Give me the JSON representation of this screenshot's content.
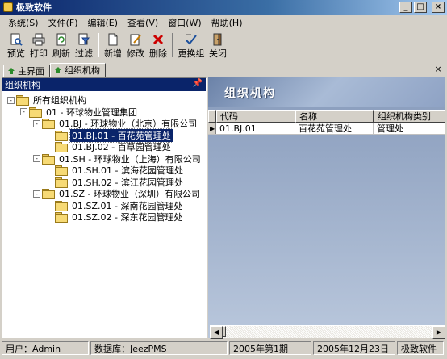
{
  "window": {
    "title": "极致软件"
  },
  "menu": [
    "系统(S)",
    "文件(F)",
    "编辑(E)",
    "查看(V)",
    "窗口(W)",
    "帮助(H)"
  ],
  "toolbar": [
    {
      "label": "预览",
      "icon": "preview-icon"
    },
    {
      "label": "打印",
      "icon": "print-icon"
    },
    {
      "label": "刷新",
      "icon": "refresh-icon"
    },
    {
      "label": "过滤",
      "icon": "filter-icon"
    },
    {
      "label": "新增",
      "icon": "add-icon"
    },
    {
      "label": "修改",
      "icon": "edit-icon"
    },
    {
      "label": "删除",
      "icon": "delete-icon"
    },
    {
      "label": "更换组",
      "icon": "change-group-icon"
    },
    {
      "label": "关闭",
      "icon": "close-icon"
    }
  ],
  "tabs": [
    {
      "label": "主界面"
    },
    {
      "label": "组织机构"
    }
  ],
  "left_panel": {
    "title": "组织机构",
    "tree": [
      {
        "label": "所有组织机构",
        "level": 0,
        "expander": "-"
      },
      {
        "label": "01 - 环球物业管理集团",
        "level": 1,
        "expander": "-"
      },
      {
        "label": "01.BJ - 环球物业（北京）有限公司",
        "level": 2,
        "expander": "-"
      },
      {
        "label": "01.BJ.01 - 百花苑管理处",
        "level": 3,
        "expander": "",
        "selected": true
      },
      {
        "label": "01.BJ.02 - 百草园管理处",
        "level": 3,
        "expander": ""
      },
      {
        "label": "01.SH - 环球物业（上海）有限公司",
        "level": 2,
        "expander": "-"
      },
      {
        "label": "01.SH.01 - 滨海花园管理处",
        "level": 3,
        "expander": ""
      },
      {
        "label": "01.SH.02 - 滨江花园管理处",
        "level": 3,
        "expander": ""
      },
      {
        "label": "01.SZ - 环球物业（深圳）有限公司",
        "level": 2,
        "expander": "-"
      },
      {
        "label": "01.SZ.01 - 深南花园管理处",
        "level": 3,
        "expander": ""
      },
      {
        "label": "01.SZ.02 - 深东花园管理处",
        "level": 3,
        "expander": ""
      }
    ]
  },
  "right_panel": {
    "banner_title": "组织机构",
    "columns": [
      "代码",
      "名称",
      "组织机构类别"
    ],
    "rows": [
      {
        "code": "01.BJ.01",
        "name": "百花苑管理处",
        "category": "管理处"
      }
    ]
  },
  "statusbar": {
    "user": "用户：Admin",
    "database": "数据库：JeezPMS",
    "period": "2005年第1期",
    "date": "2005年12月23日",
    "brand": "极致软件"
  }
}
